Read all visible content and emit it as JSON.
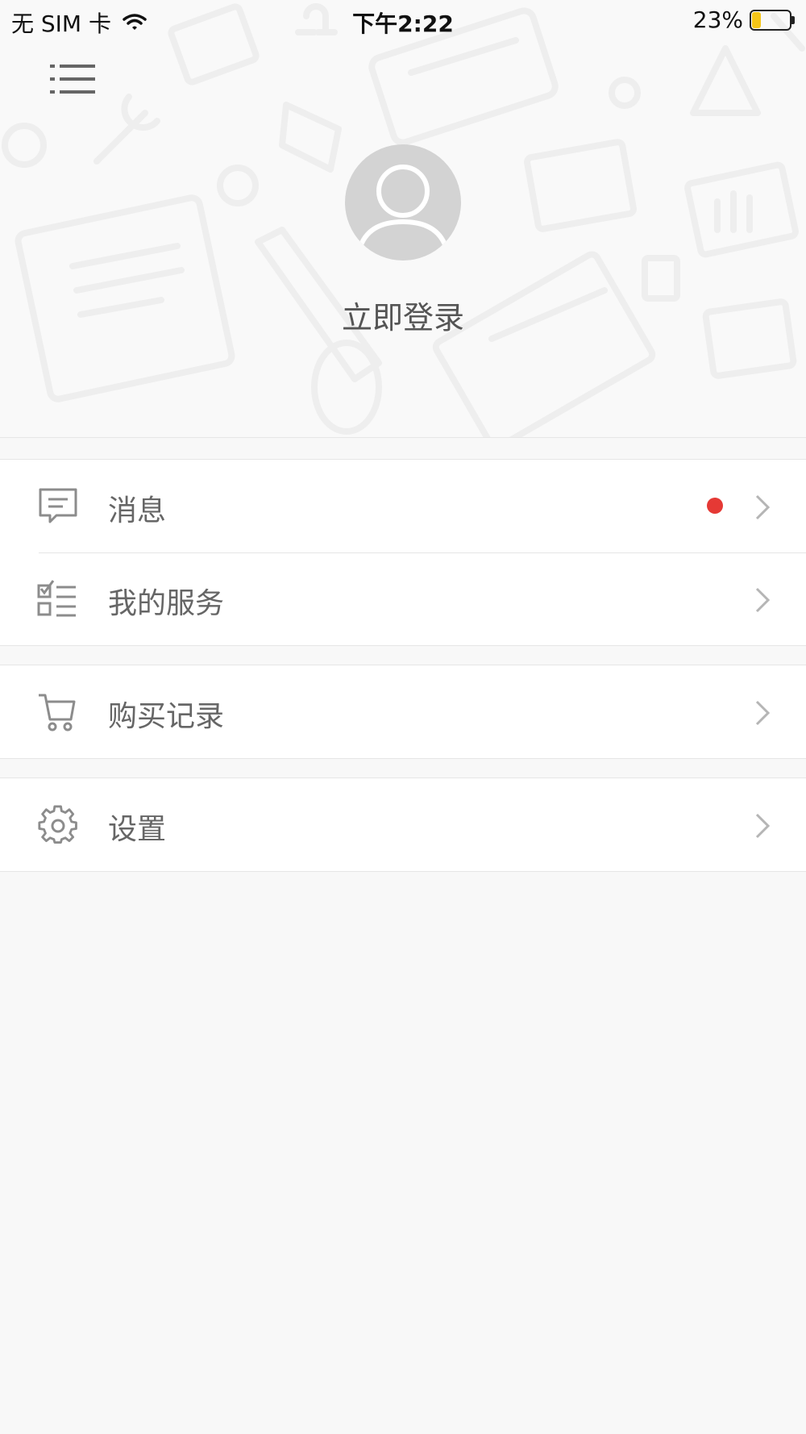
{
  "status_bar": {
    "carrier": "无 SIM 卡",
    "time": "下午2:22",
    "battery_percent_text": "23%",
    "battery_level": 0.23,
    "battery_fill_color": "#f5c518"
  },
  "header": {
    "menu_icon": "list-icon",
    "avatar_icon": "user-placeholder-icon",
    "login_label": "立即登录"
  },
  "menu_groups": [
    {
      "items": [
        {
          "label": "消息",
          "icon": "message-icon",
          "unread": true
        },
        {
          "label": "我的服务",
          "icon": "checklist-icon",
          "unread": false
        }
      ]
    },
    {
      "items": [
        {
          "label": "购买记录",
          "icon": "cart-icon",
          "unread": false
        }
      ]
    },
    {
      "items": [
        {
          "label": "设置",
          "icon": "gear-icon",
          "unread": false
        }
      ]
    }
  ],
  "colors": {
    "unread_dot": "#e53935",
    "icon_gray": "#8c8c8c",
    "chevron_gray": "#b5b5b5"
  }
}
